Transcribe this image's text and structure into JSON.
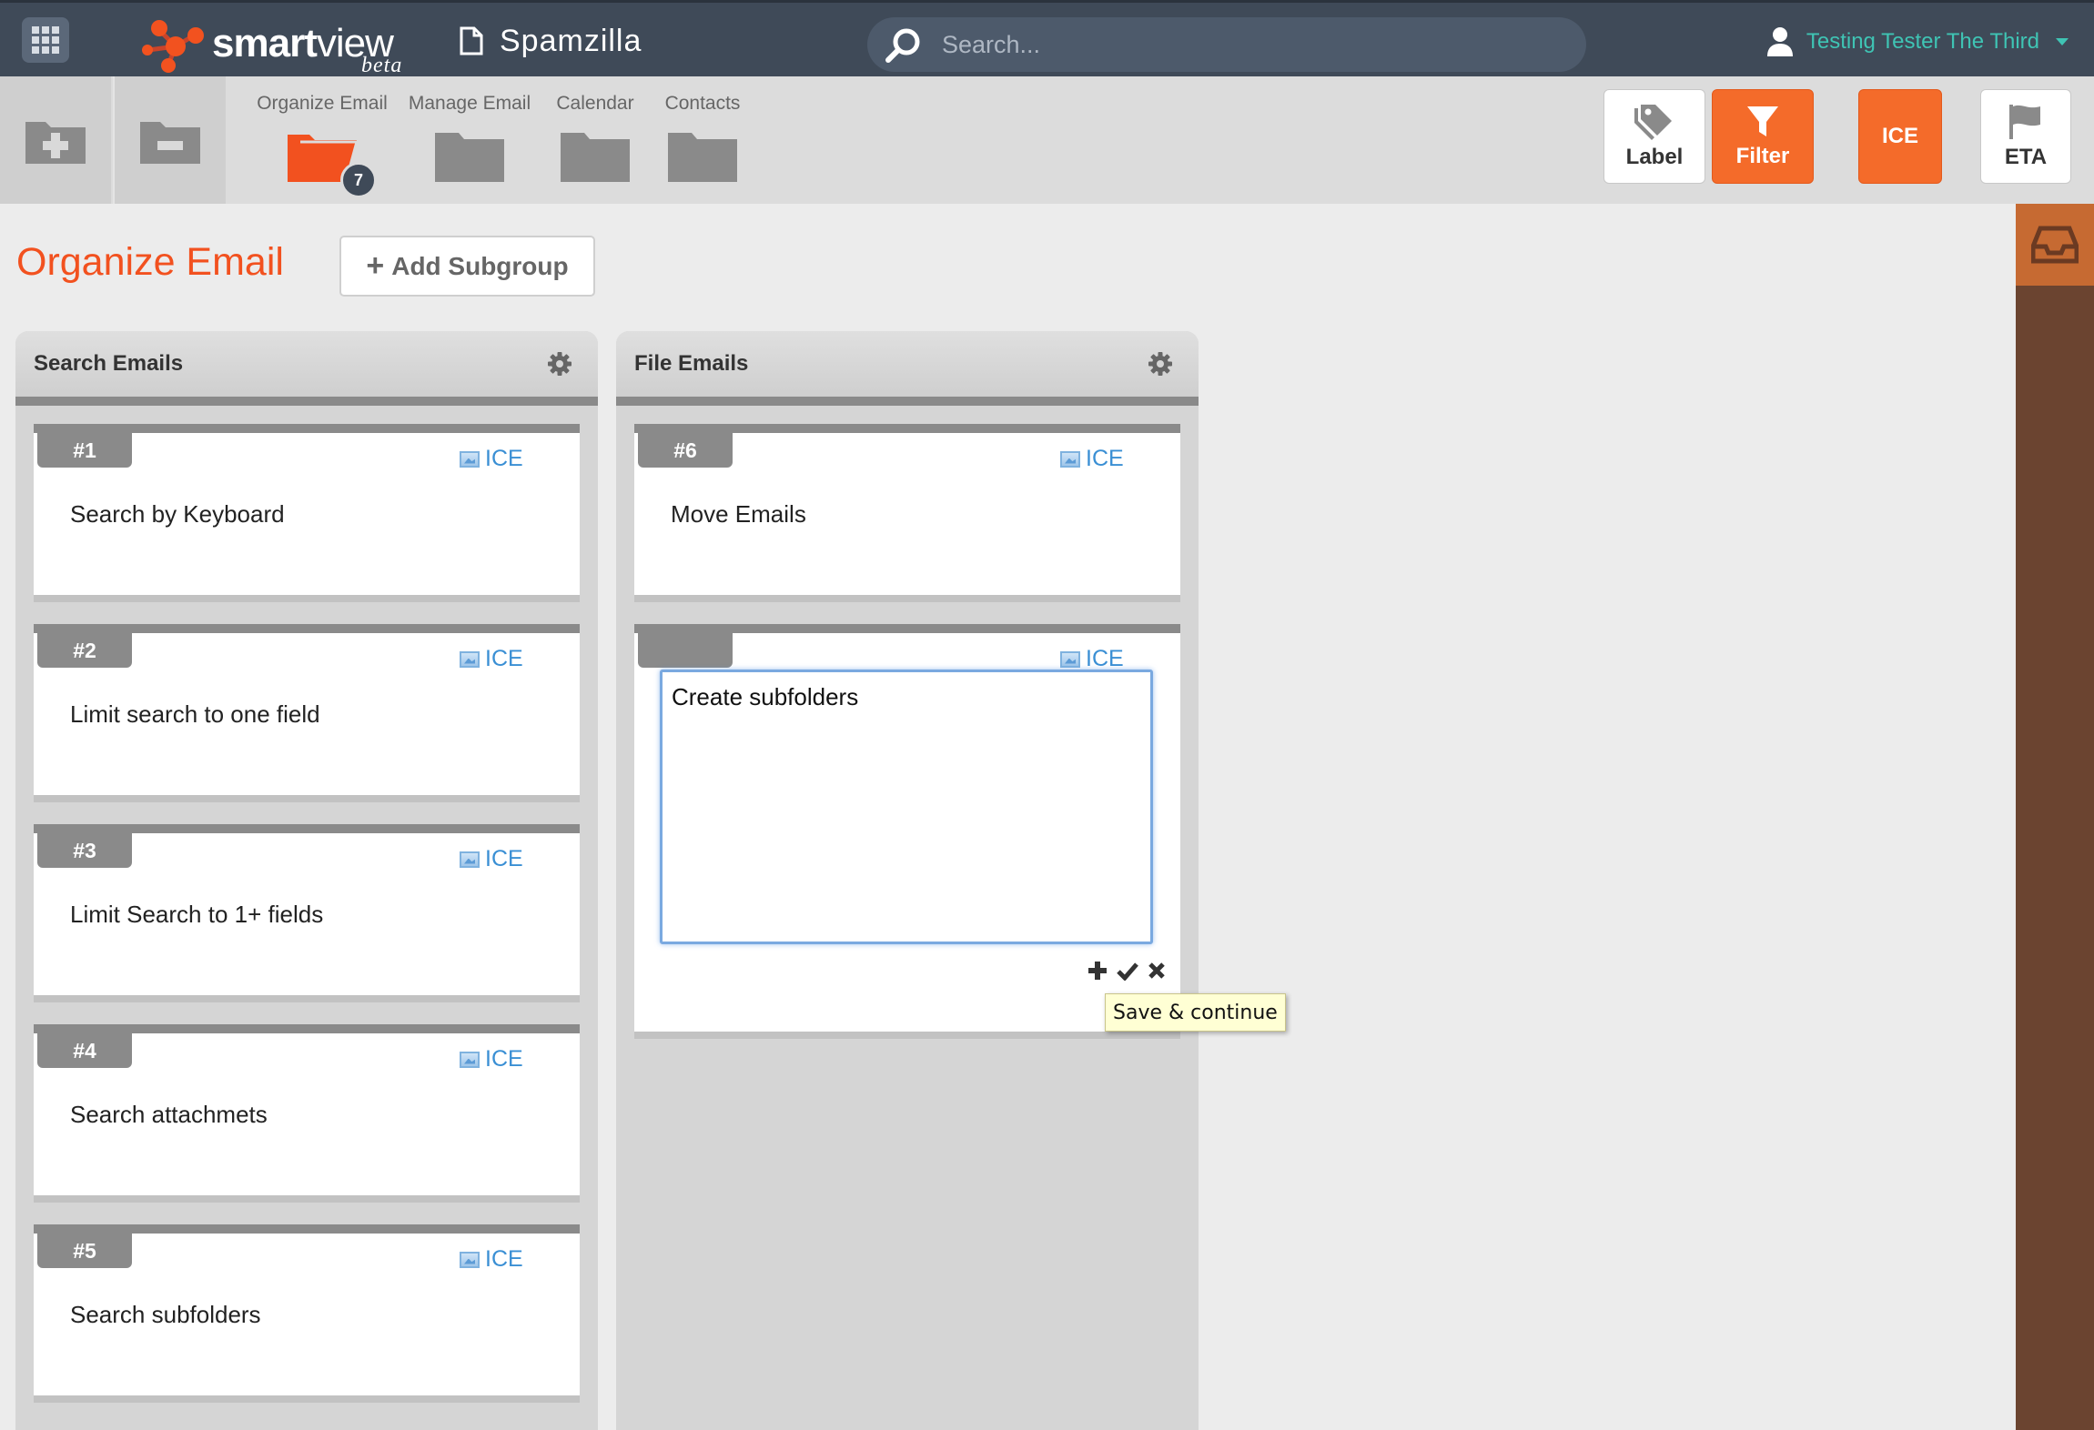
{
  "navbar": {
    "brand_smart": "smart",
    "brand_view": "view",
    "brand_beta": "beta",
    "project_name": "Spamzilla",
    "search_placeholder": "Search...",
    "user_name": "Testing Tester The Third"
  },
  "toolbar": {
    "folders": [
      {
        "label": "Organize Email",
        "badge": "7",
        "active": true
      },
      {
        "label": "Manage Email"
      },
      {
        "label": "Calendar"
      },
      {
        "label": "Contacts"
      }
    ],
    "buttons": {
      "label": "Label",
      "filter": "Filter",
      "ice": "ICE",
      "eta": "ETA"
    }
  },
  "page": {
    "title": "Organize Email",
    "add_subgroup": "Add Subgroup",
    "plus": "+"
  },
  "columns": [
    {
      "title": "Search Emails",
      "cards": [
        {
          "tag": "#1",
          "ice": "ICE",
          "text": "Search by Keyboard"
        },
        {
          "tag": "#2",
          "ice": "ICE",
          "text": "Limit search to one field"
        },
        {
          "tag": "#3",
          "ice": "ICE",
          "text": "Limit Search to 1+ fields"
        },
        {
          "tag": "#4",
          "ice": "ICE",
          "text": "Search attachmets"
        },
        {
          "tag": "#5",
          "ice": "ICE",
          "text": "Search subfolders"
        }
      ]
    },
    {
      "title": "File Emails",
      "cards": [
        {
          "tag": "#6",
          "ice": "ICE",
          "text": "Move Emails"
        }
      ],
      "editor": {
        "tag": "",
        "ice": "ICE",
        "value": "Create subfolders"
      }
    }
  ],
  "tooltip": "Save & continue",
  "colors": {
    "navbar": "#3f4a58",
    "accent_orange": "#f46b2a",
    "title_orange": "#f2511f",
    "user_teal": "#3fc4b4",
    "link_blue": "#3a8fd4",
    "rail_brown": "#6b4430"
  }
}
